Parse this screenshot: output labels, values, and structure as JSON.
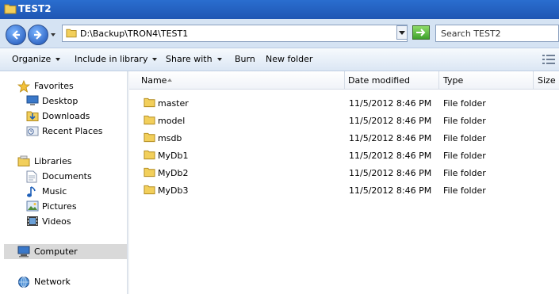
{
  "window": {
    "title": "TEST2"
  },
  "navigation": {
    "address_path": "D:\\Backup\\TRON4\\TEST1",
    "search_placeholder": "Search TEST2"
  },
  "toolbar": {
    "organize": "Organize",
    "include_in_library": "Include in library",
    "share_with": "Share with",
    "burn": "Burn",
    "new_folder": "New folder"
  },
  "sidebar": {
    "favorites": {
      "label": "Favorites",
      "items": [
        {
          "label": "Desktop",
          "icon": "desktop-icon"
        },
        {
          "label": "Downloads",
          "icon": "downloads-icon"
        },
        {
          "label": "Recent Places",
          "icon": "recent-places-icon"
        }
      ]
    },
    "libraries": {
      "label": "Libraries",
      "items": [
        {
          "label": "Documents",
          "icon": "documents-icon"
        },
        {
          "label": "Music",
          "icon": "music-icon"
        },
        {
          "label": "Pictures",
          "icon": "pictures-icon"
        },
        {
          "label": "Videos",
          "icon": "videos-icon"
        }
      ]
    },
    "computer": {
      "label": "Computer",
      "selected": true
    },
    "network": {
      "label": "Network"
    }
  },
  "file_list": {
    "columns": {
      "name": "Name",
      "date_modified": "Date modified",
      "type": "Type",
      "size": "Size"
    },
    "rows": [
      {
        "name": "master",
        "date": "11/5/2012 8:46 PM",
        "type": "File folder"
      },
      {
        "name": "model",
        "date": "11/5/2012 8:46 PM",
        "type": "File folder"
      },
      {
        "name": "msdb",
        "date": "11/5/2012 8:46 PM",
        "type": "File folder"
      },
      {
        "name": "MyDb1",
        "date": "11/5/2012 8:46 PM",
        "type": "File folder"
      },
      {
        "name": "MyDb2",
        "date": "11/5/2012 8:46 PM",
        "type": "File folder"
      },
      {
        "name": "MyDb3",
        "date": "11/5/2012 8:46 PM",
        "type": "File folder"
      }
    ]
  },
  "colors": {
    "title_bar": "#1f56b3",
    "nav_bar": "#d5e3f3",
    "selected_item": "#d9d9d9",
    "folder": "#e8c14a"
  }
}
